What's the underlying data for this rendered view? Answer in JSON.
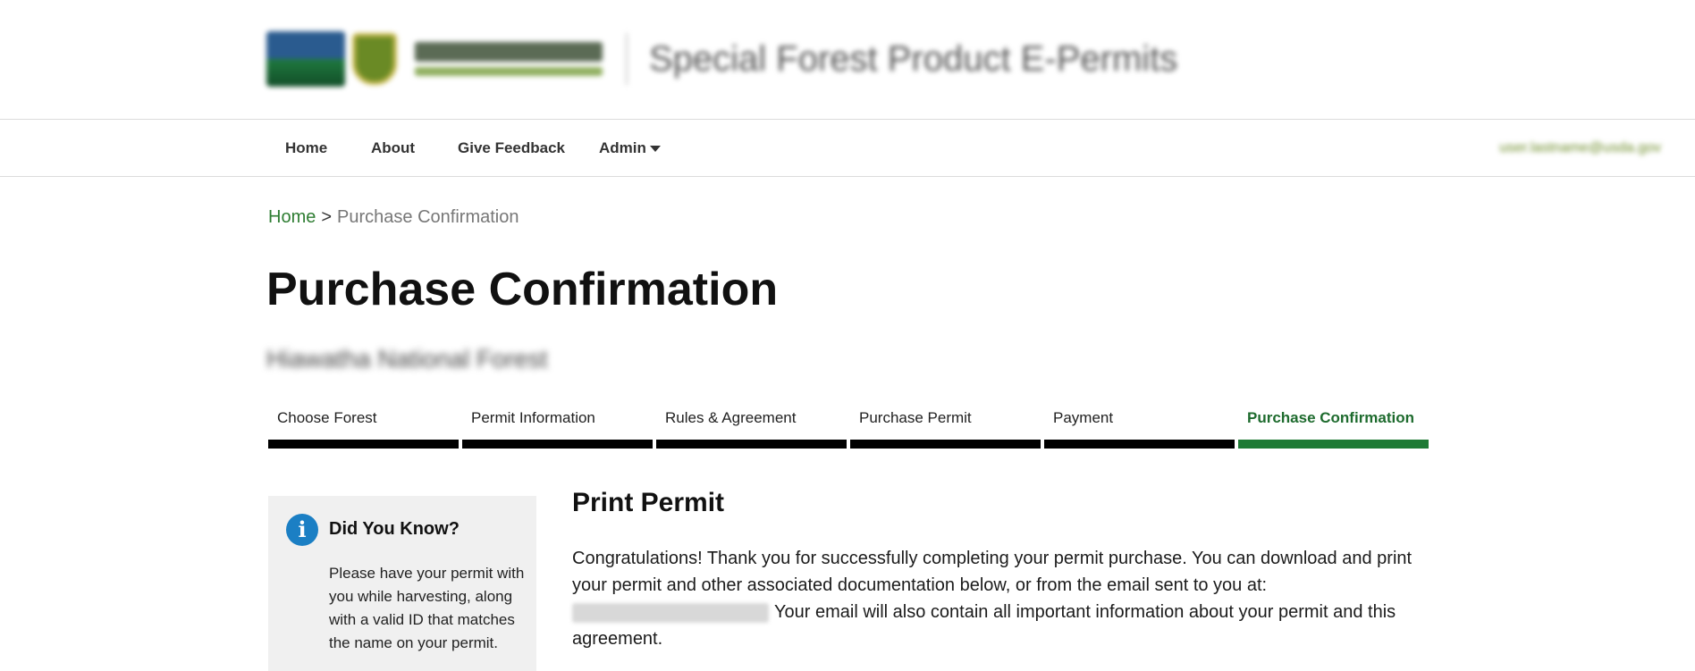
{
  "header": {
    "app_title": "Special Forest Product E-Permits"
  },
  "nav": {
    "items": [
      {
        "label": "Home"
      },
      {
        "label": "About"
      },
      {
        "label": "Give Feedback"
      },
      {
        "label": "Admin"
      }
    ],
    "user_email": "user.lastname@usda.gov"
  },
  "breadcrumb": {
    "home": "Home",
    "separator": ">",
    "current": "Purchase Confirmation"
  },
  "page": {
    "title": "Purchase Confirmation",
    "forest_name": "Hiawatha National Forest"
  },
  "steps": [
    {
      "label": "Choose Forest",
      "active": false
    },
    {
      "label": "Permit Information",
      "active": false
    },
    {
      "label": "Rules & Agreement",
      "active": false
    },
    {
      "label": "Purchase Permit",
      "active": false
    },
    {
      "label": "Payment",
      "active": false
    },
    {
      "label": "Purchase Confirmation",
      "active": true
    }
  ],
  "sidebar": {
    "title": "Did You Know?",
    "text": "Please have your permit with you while harvesting, along with a valid ID that matches the name on your permit."
  },
  "main": {
    "section_title": "Print Permit",
    "paragraph_start": "Congratulations! Thank you for successfully completing your permit purchase. You can download and print your permit and other associated documentation below, or from the email sent to you at:",
    "paragraph_end": "Your email will also contain all important information about your permit and this agreement."
  },
  "colors": {
    "link_green": "#2e7d32",
    "active_step_green": "#1e7a35",
    "info_blue": "#1b7fc4"
  }
}
